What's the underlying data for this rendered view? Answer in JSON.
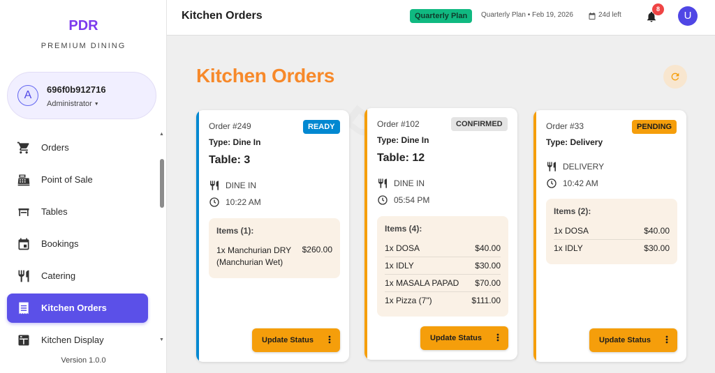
{
  "sidebar": {
    "brand": "PDR",
    "brand_sub": "PREMIUM DINING",
    "user": {
      "avatar_letter": "A",
      "name": "696f0b912716",
      "role": "Administrator"
    },
    "items": [
      {
        "label": "Orders",
        "icon": "cart-icon"
      },
      {
        "label": "Point of Sale",
        "icon": "cash-register-icon"
      },
      {
        "label": "Tables",
        "icon": "table-icon"
      },
      {
        "label": "Bookings",
        "icon": "calendar-icon"
      },
      {
        "label": "Catering",
        "icon": "restaurant-icon"
      },
      {
        "label": "Kitchen Orders",
        "icon": "receipt-icon",
        "active": true
      },
      {
        "label": "Kitchen Display",
        "icon": "display-icon"
      }
    ],
    "version": "Version 1.0.0"
  },
  "header": {
    "title": "Kitchen Orders",
    "plan_badge": "Quarterly Plan",
    "plan_info": "Quarterly Plan • Feb 19, 2026",
    "days_left": "24d left",
    "notification_count": "8",
    "user_letter": "U"
  },
  "main": {
    "title": "Kitchen Orders",
    "cards": [
      {
        "order": "Order #249",
        "status": "READY",
        "type": "Type: Dine In",
        "table": "Table: 3",
        "service": "DINE IN",
        "time": "10:22 AM",
        "items_title": "Items (1):",
        "items": [
          {
            "name": "1x Manchurian DRY (Manchurian Wet)",
            "price": "$260.00"
          }
        ],
        "button": "Update Status"
      },
      {
        "order": "Order #102",
        "status": "CONFIRMED",
        "type": "Type: Dine In",
        "table": "Table: 12",
        "service": "DINE IN",
        "time": "05:54 PM",
        "items_title": "Items (4):",
        "items": [
          {
            "name": "1x DOSA",
            "price": "$40.00"
          },
          {
            "name": "1x IDLY",
            "price": "$30.00"
          },
          {
            "name": "1x MASALA PAPAD",
            "price": "$70.00"
          },
          {
            "name": "1x Pizza (7\")",
            "price": "$111.00"
          }
        ],
        "button": "Update Status"
      },
      {
        "order": "Order #33",
        "status": "PENDING",
        "type": "Type: Delivery",
        "service": "DELIVERY",
        "time": "10:42 AM",
        "items_title": "Items (2):",
        "items": [
          {
            "name": "1x DOSA",
            "price": "$40.00"
          },
          {
            "name": "1x IDLY",
            "price": "$30.00"
          }
        ],
        "button": "Update Status"
      }
    ]
  },
  "colors": {
    "brand": "#7c3aed",
    "accent": "#5b50e8",
    "orange_title": "#f7892a",
    "ready": "#0288d1",
    "confirmed": "#e0e0e0",
    "pending": "#f59e0b",
    "plan_badge": "#10b981",
    "notification": "#ef4444"
  }
}
